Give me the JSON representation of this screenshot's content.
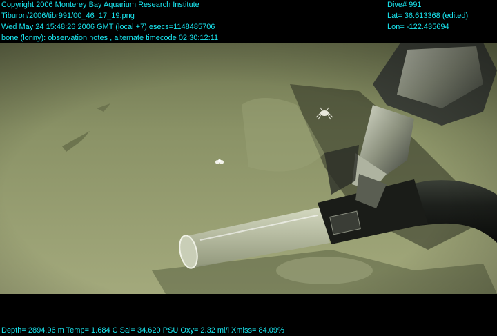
{
  "overlay": {
    "top_left": [
      "Copyright 2006 Monterey Bay Aquarium Research Institute",
      "Tiburon/2006/tibr991/00_46_17_19.png",
      "Wed May 24 15:48:26 2006 GMT (local +7)  esecs=1148485706",
      "bone (lonny): observation notes , alternate timecode 02:30:12:11"
    ],
    "top_right": [
      "Dive# 991",
      "Lat= 36.613368 (edited)",
      "Lon= -122.435694"
    ],
    "bottom": "Depth= 2894.96 m  Temp= 1.684 C  Sal= 34.620 PSU  Oxy= 2.32 ml/l  Xmiss= 84.09%"
  },
  "colors": {
    "overlay_text": "#19e6f0",
    "background": "#000000",
    "seafloor": "#8d9568"
  },
  "scene": {
    "objects": [
      "seafloor",
      "manipulator-claw",
      "push-core-tube",
      "hose",
      "small-crab",
      "white-organism"
    ]
  }
}
